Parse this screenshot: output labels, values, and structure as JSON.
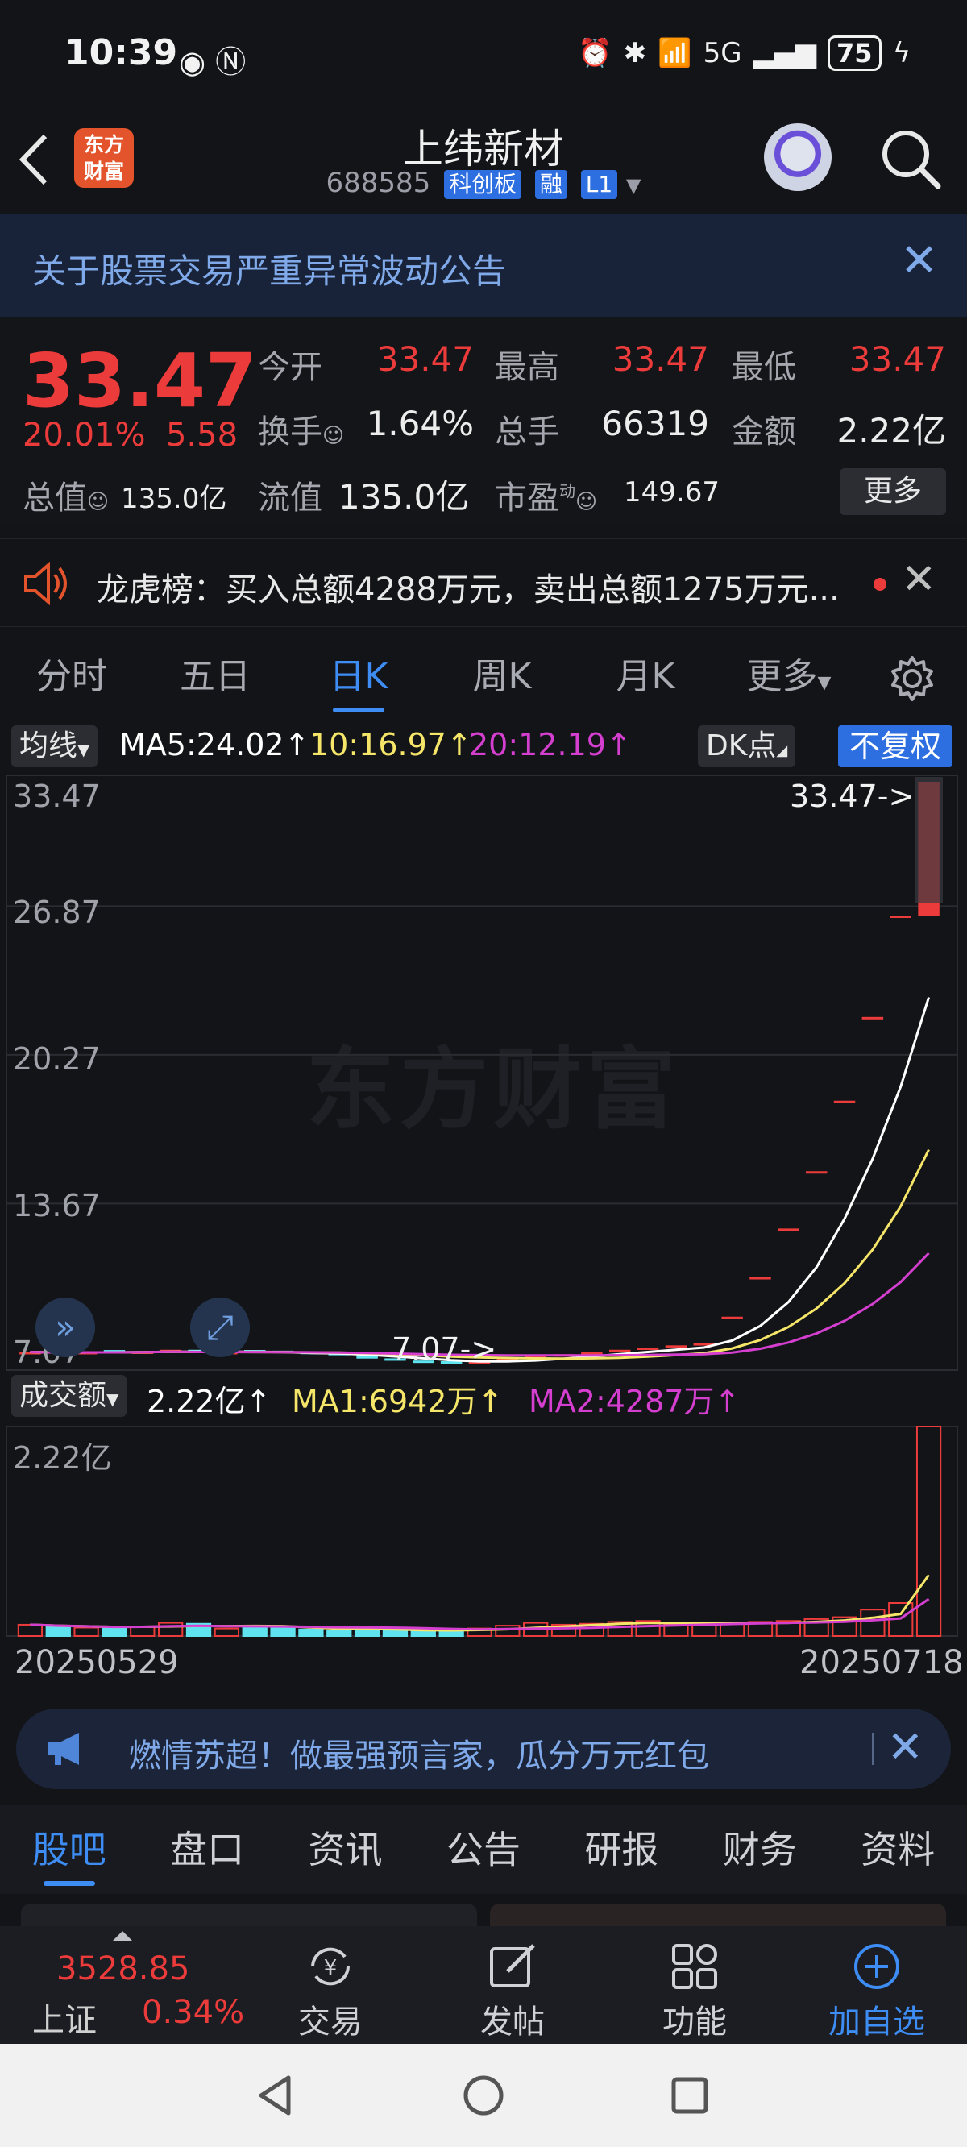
{
  "status_bar": {
    "time": "10:39",
    "battery": "75",
    "network": "5G"
  },
  "header": {
    "logo_text_1": "东方",
    "logo_text_2": "财富",
    "stock_name": "上纬新材",
    "stock_code": "688585",
    "tag_board": "科创板",
    "tag_margin": "融",
    "tag_level": "L1"
  },
  "notice": {
    "text": "关于股票交易严重异常波动公告"
  },
  "quote": {
    "price": "33.47",
    "change_pct": "20.01%",
    "change_amt": "5.58",
    "open_label": "今开",
    "open": "33.47",
    "high_label": "最高",
    "high": "33.47",
    "low_label": "最低",
    "low": "33.47",
    "turnover_label": "换手",
    "turnover": "1.64%",
    "volume_label": "总手",
    "volume": "66319",
    "amount_label": "金额",
    "amount": "2.22亿",
    "mktcap_label": "总值",
    "mktcap": "135.0亿",
    "float_label": "流值",
    "float": "135.0亿",
    "pe_label": "市盈",
    "pe_sup": "动",
    "pe": "149.67",
    "more_label": "更多"
  },
  "dragon_tiger": {
    "text": "龙虎榜：买入总额4288万元，卖出总额1275万元..."
  },
  "period_tabs": [
    "分时",
    "五日",
    "日K",
    "周K",
    "月K",
    "更多"
  ],
  "active_period": "日K",
  "ma_legend": {
    "selector": "均线",
    "ma5": "MA5:24.02↑",
    "ma10": "10:16.97↑",
    "ma20": "20:12.19↑",
    "dk": "DK点",
    "adjust": "不复权"
  },
  "kline_axis": [
    "33.47",
    "26.87",
    "20.27",
    "13.67",
    "7.07"
  ],
  "kline_watermark": "东方财富",
  "kline_max_tag": "33.47->",
  "kline_min_tag": "7.07->",
  "colors": {
    "up": "#ec3b3b",
    "down": "#5fe3ef",
    "ma5": "#ffffff",
    "ma10": "#f5e66a",
    "ma20": "#d43fd0",
    "accent": "#3d8df5"
  },
  "chart_data": {
    "type": "candlestick",
    "ylim": [
      7.07,
      33.47
    ],
    "closes": [
      7.6,
      7.55,
      7.6,
      7.58,
      7.62,
      7.7,
      7.55,
      7.6,
      7.58,
      7.55,
      7.5,
      7.45,
      7.3,
      7.2,
      7.1,
      7.07,
      7.2,
      7.3,
      7.4,
      7.5,
      7.6,
      7.7,
      7.8,
      7.9,
      8.0,
      9.2,
      11.0,
      13.2,
      15.8,
      19.0,
      22.8,
      27.4,
      33.47
    ],
    "ma5_last": 24.02,
    "ma10_last": 16.97,
    "ma20_last": 12.19,
    "volume": {
      "selector": "成交额",
      "value": "2.22亿↑",
      "ma1": "MA1:6942万↑",
      "ma2": "MA2:4287万↑",
      "axis_max": "2.22亿",
      "values": [
        0.12,
        0.1,
        0.09,
        0.08,
        0.1,
        0.14,
        0.13,
        0.08,
        0.09,
        0.09,
        0.07,
        0.06,
        0.07,
        0.06,
        0.05,
        0.06,
        0.08,
        0.11,
        0.14,
        0.12,
        0.13,
        0.15,
        0.16,
        0.13,
        0.12,
        0.14,
        0.15,
        0.16,
        0.18,
        0.2,
        0.28,
        0.35,
        2.22
      ],
      "start_date": "20250529",
      "end_date": "20250718"
    }
  },
  "banner": {
    "text": "燃情苏超！做最强预言家，瓜分万元红包"
  },
  "info_tabs": [
    "股吧",
    "盘口",
    "资讯",
    "公告",
    "研报",
    "财务",
    "资料"
  ],
  "active_info_tab": "股吧",
  "toolbar": {
    "index_value": "3528.85",
    "index_name": "上证",
    "index_pct": "0.34%",
    "items": [
      "交易",
      "发帖",
      "功能",
      "加自选"
    ]
  }
}
